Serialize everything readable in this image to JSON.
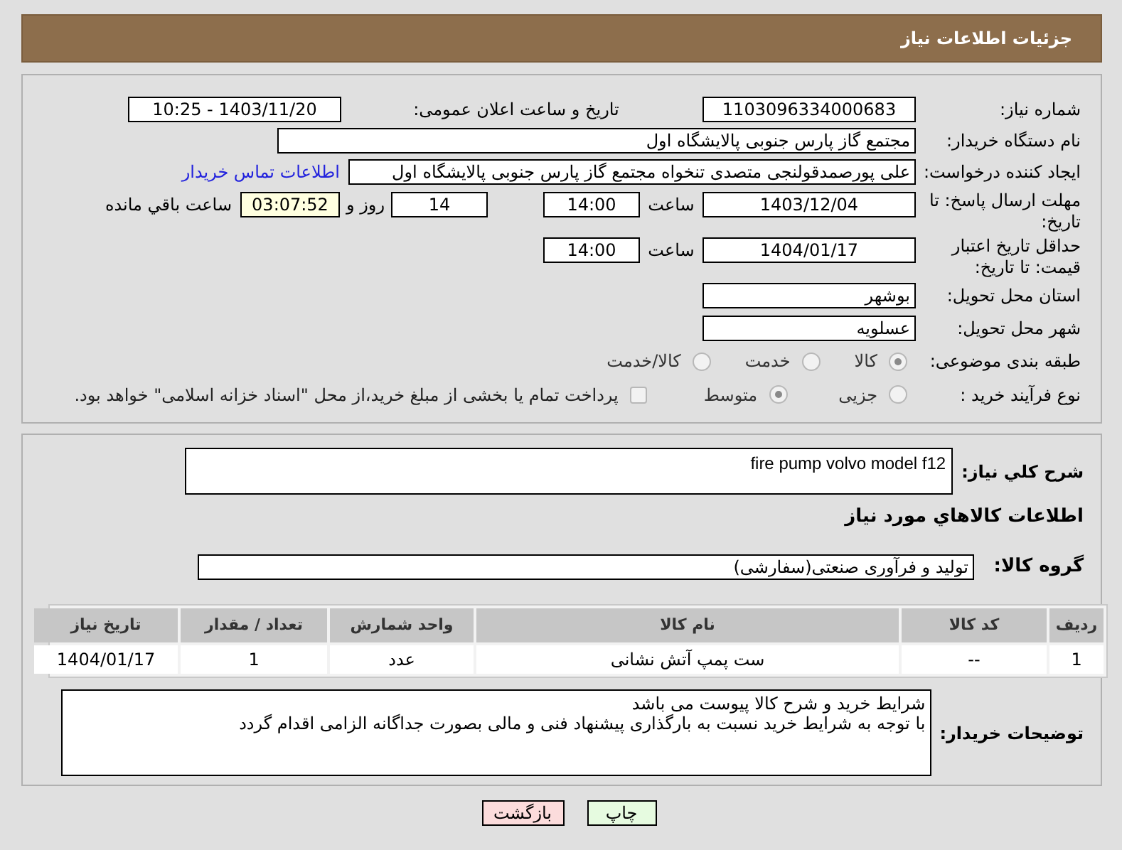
{
  "header": {
    "title": "جزئیات اطلاعات نیاز"
  },
  "need_number": {
    "label": "شماره نیاز:",
    "value": "1103096334000683"
  },
  "announce": {
    "label": "تاریخ و ساعت اعلان عمومی:",
    "value": "1403/11/20 - 10:25"
  },
  "buyer": {
    "label": "نام دستگاه خریدار:",
    "value": "مجتمع گاز پارس جنوبی  پالایشگاه اول"
  },
  "requester": {
    "label": "ایجاد کننده درخواست:",
    "value": "علی پورصمدقولنجی متصدی تنخواه مجتمع گاز پارس جنوبی  پالایشگاه اول",
    "link": "اطلاعات تماس خریدار"
  },
  "response_deadline": {
    "label": "مهلت ارسال پاسخ: تا تاریخ:",
    "date": "1403/12/04",
    "time_label": "ساعت",
    "time": "14:00",
    "days": "14",
    "days_label": "روز و",
    "remaining": "03:07:52",
    "remaining_label": "ساعت باقي مانده"
  },
  "price_validity": {
    "label": "حداقل تاریخ اعتبار قیمت: تا تاریخ:",
    "date": "1404/01/17",
    "time_label": "ساعت",
    "time": "14:00"
  },
  "province": {
    "label": "استان محل تحویل:",
    "value": "بوشهر"
  },
  "city": {
    "label": "شهر محل تحویل:",
    "value": "عسلویه"
  },
  "category": {
    "label": "طبقه بندی موضوعی:",
    "options": [
      {
        "label": "کالا",
        "selected": true
      },
      {
        "label": "خدمت",
        "selected": false
      },
      {
        "label": "کالا/خدمت",
        "selected": false
      }
    ]
  },
  "process": {
    "label": "نوع فرآیند خرید :",
    "options": [
      {
        "label": "جزیی",
        "selected": false
      },
      {
        "label": "متوسط",
        "selected": true
      }
    ],
    "payment": {
      "label": "پرداخت تمام یا بخشی از مبلغ خرید،از محل \"اسناد خزانه اسلامی\" خواهد بود.",
      "checked": false
    }
  },
  "description": {
    "label": "شرح كلي نياز:",
    "value": "fire pump volvo model f12"
  },
  "goods_title": "اطلاعات كالاهاي مورد نياز",
  "goods_group": {
    "label": "گروه کالا:",
    "value": "تولید و فرآوری صنعتی(سفارشی)"
  },
  "table": {
    "columns": [
      "ردیف",
      "کد کالا",
      "نام کالا",
      "واحد شمارش",
      "تعداد / مقدار",
      "تاریخ نیاز"
    ],
    "rows": [
      [
        "1",
        "--",
        "ست پمپ آتش نشانی",
        "عدد",
        "1",
        "1404/01/17"
      ]
    ]
  },
  "buyer_notes": {
    "label": "توضیحات خریدار:",
    "lines": [
      "شرایط خرید و شرح کالا  پیوست می باشد",
      "با توجه به شرایط خرید نسبت به بارگذاری پیشنهاد فنی و مالی بصورت جداگانه الزامی اقدام گردد"
    ]
  },
  "buttons": [
    {
      "label": "چاپ",
      "kind": "print"
    },
    {
      "label": "بازگشت",
      "kind": "back"
    }
  ]
}
